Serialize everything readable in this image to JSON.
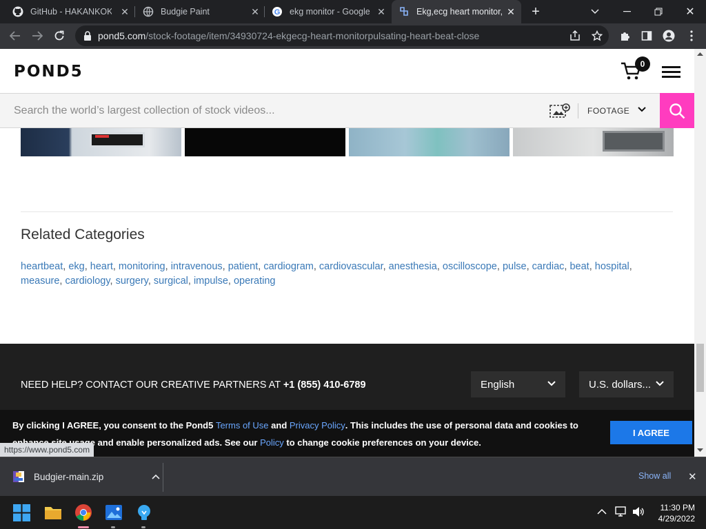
{
  "browser": {
    "tabs": [
      {
        "title": "GitHub - HAKANKOKC",
        "icon": "github-icon"
      },
      {
        "title": "Budgie Paint",
        "icon": "globe-icon"
      },
      {
        "title": "ekg monitor - Google S",
        "icon": "google-icon"
      },
      {
        "title": "Ekg,ecg heart monitor,",
        "icon": "pond5-icon",
        "active": true
      }
    ],
    "url_host": "pond5.com",
    "url_path": "/stock-footage/item/34930724-ekgecg-heart-monitorpulsating-heart-beat-close",
    "status_url": "https://www.pond5.com"
  },
  "site": {
    "logo": "POND5",
    "cart_count": "0",
    "search_placeholder": "Search the world’s largest collection of stock videos...",
    "search_type": "FOOTAGE"
  },
  "related": {
    "title": "Related Categories",
    "tags": [
      "heartbeat",
      "ekg",
      "heart",
      "monitoring",
      "intravenous",
      "patient",
      "cardiogram",
      "cardiovascular",
      "anesthesia",
      "oscilloscope",
      "pulse",
      "cardiac",
      "beat",
      "hospital",
      "measure",
      "cardiology",
      "surgery",
      "surgical",
      "impulse",
      "operating"
    ]
  },
  "footer": {
    "help_text": "NEED HELP? CONTACT OUR CREATIVE PARTNERS AT ",
    "help_phone": "+1 (855) 410-6789",
    "language": "English",
    "currency": "U.S. dollars..."
  },
  "cookie": {
    "part1": "By clicking I AGREE, you consent to the Pond5 ",
    "terms": "Terms of Use",
    "and": " and ",
    "privacy": "Privacy Policy",
    "part2": ". This includes the use of personal data and cookies to enhance site usage and enable personalized ads. See our ",
    "policy": "Policy",
    "part3": " to change cookie preferences on your device.",
    "agree_label": "I AGREE"
  },
  "downloads": {
    "file": "Budgier-main.zip",
    "show_all": "Show all"
  },
  "taskbar": {
    "time": "11:30 PM",
    "date": "4/29/2022"
  },
  "colors": {
    "search_button": "#ff3cbf",
    "agree_button": "#1c78e8",
    "tag_link": "#3a79b7"
  }
}
